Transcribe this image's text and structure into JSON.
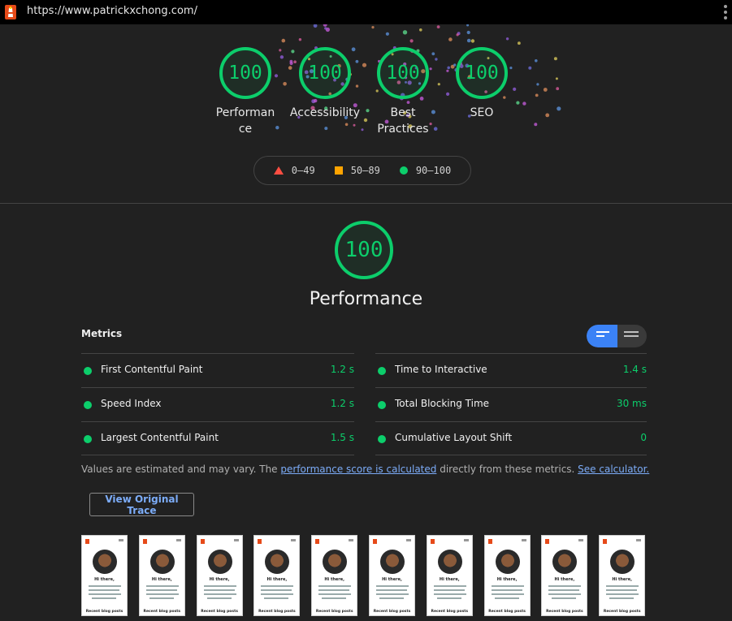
{
  "browser": {
    "url": "https://www.patrickxchong.com/"
  },
  "categories": [
    {
      "score": "100",
      "label": "Performance"
    },
    {
      "score": "100",
      "label": "Accessibility"
    },
    {
      "score": "100",
      "label": "Best Practices"
    },
    {
      "score": "100",
      "label": "SEO"
    }
  ],
  "legend": {
    "fail": "0–49",
    "average": "50–89",
    "pass": "90–100"
  },
  "performance": {
    "score": "100",
    "title": "Performance"
  },
  "metrics": {
    "heading": "Metrics",
    "left": [
      {
        "name": "First Contentful Paint",
        "value": "1.2 s"
      },
      {
        "name": "Speed Index",
        "value": "1.2 s"
      },
      {
        "name": "Largest Contentful Paint",
        "value": "1.5 s"
      }
    ],
    "right": [
      {
        "name": "Time to Interactive",
        "value": "1.4 s"
      },
      {
        "name": "Total Blocking Time",
        "value": "30 ms"
      },
      {
        "name": "Cumulative Layout Shift",
        "value": "0"
      }
    ]
  },
  "note": {
    "prefix": "Values are estimated and may vary. The ",
    "link1": "performance score is calculated",
    "middle": " directly from these metrics. ",
    "link2": "See calculator."
  },
  "trace_button": "View Original Trace",
  "filmstrip": {
    "greeting": "Hi there,",
    "footer": "Recent blog posts"
  },
  "colors": {
    "pass": "#0cce6b",
    "average": "#ffa400",
    "fail": "#ff4e42",
    "link": "#7cacf8",
    "toggle_active": "#3b82f6"
  }
}
